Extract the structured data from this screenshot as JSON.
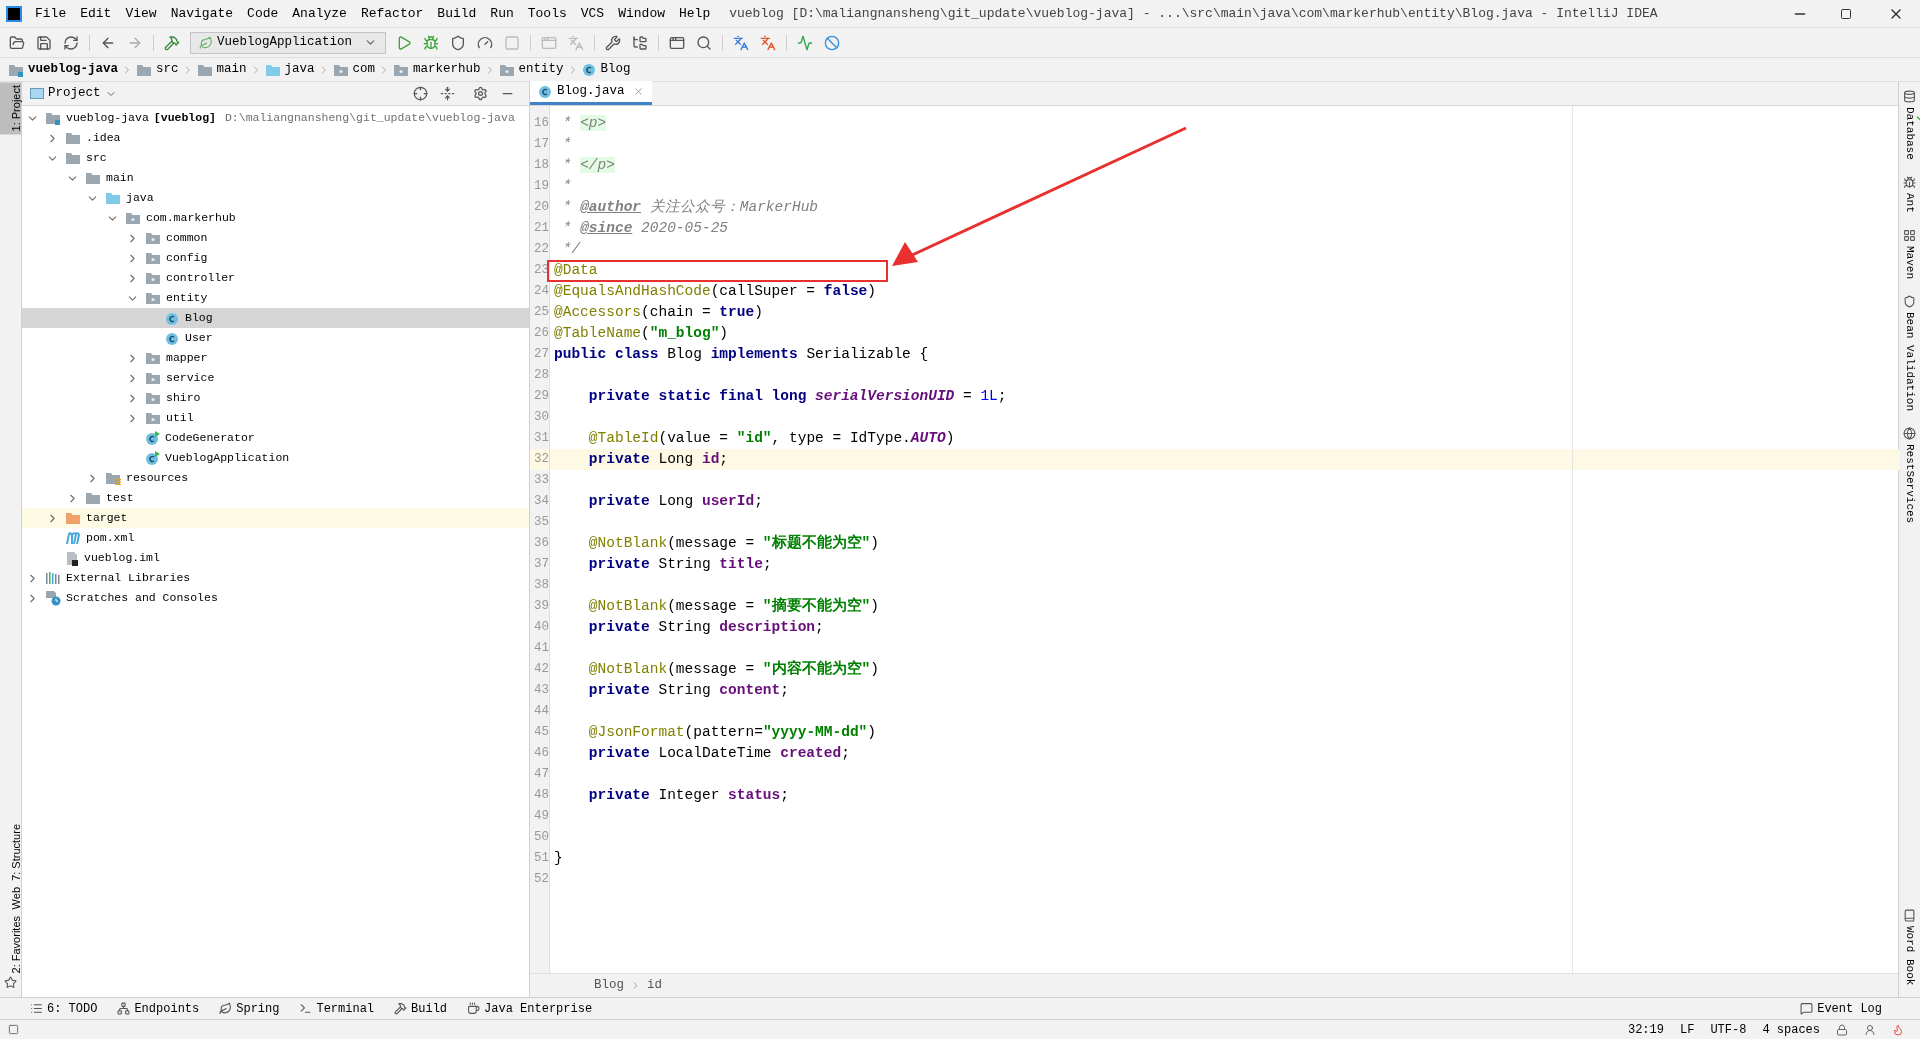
{
  "window": {
    "title": "vueblog [D:\\maliangnansheng\\git_update\\vueblog-java] - ...\\src\\main\\java\\com\\markerhub\\entity\\Blog.java - IntelliJ IDEA"
  },
  "menu": [
    "File",
    "Edit",
    "View",
    "Navigate",
    "Code",
    "Analyze",
    "Refactor",
    "Build",
    "Run",
    "Tools",
    "VCS",
    "Window",
    "Help"
  ],
  "run_config": "VueblogApplication",
  "nav_bar": [
    {
      "label": "vueblog-java",
      "kind": "module"
    },
    {
      "label": "src",
      "kind": "folder"
    },
    {
      "label": "main",
      "kind": "folder"
    },
    {
      "label": "java",
      "kind": "source-folder"
    },
    {
      "label": "com",
      "kind": "package"
    },
    {
      "label": "markerhub",
      "kind": "package"
    },
    {
      "label": "entity",
      "kind": "package"
    },
    {
      "label": "Blog",
      "kind": "class"
    }
  ],
  "left_strip": [
    {
      "label": "1: Project",
      "selected": true
    },
    {
      "label": "7: Structure",
      "selected": false
    },
    {
      "label": "Web",
      "selected": false
    },
    {
      "label": "2: Favorites",
      "selected": false
    }
  ],
  "project_panel": {
    "title": "Project",
    "tree": [
      {
        "label": "vueblog-java",
        "module_name": "[vueblog]",
        "path": "D:\\maliangnansheng\\git_update\\vueblog-java",
        "kind": "module",
        "expanded": true,
        "selected": false,
        "children": [
          {
            "label": ".idea",
            "kind": "folder",
            "expanded": false,
            "selected": false
          },
          {
            "label": "src",
            "kind": "folder",
            "expanded": true,
            "selected": false,
            "children": [
              {
                "label": "main",
                "kind": "folder",
                "expanded": true,
                "selected": false,
                "children": [
                  {
                    "label": "java",
                    "kind": "source-folder",
                    "expanded": true,
                    "selected": false,
                    "children": [
                      {
                        "label": "com.markerhub",
                        "kind": "package",
                        "expanded": true,
                        "selected": false,
                        "children": [
                          {
                            "label": "common",
                            "kind": "package",
                            "expanded": false,
                            "selected": false
                          },
                          {
                            "label": "config",
                            "kind": "package",
                            "expanded": false,
                            "selected": false
                          },
                          {
                            "label": "controller",
                            "kind": "package",
                            "expanded": false,
                            "selected": false
                          },
                          {
                            "label": "entity",
                            "kind": "package",
                            "expanded": true,
                            "selected": false,
                            "children": [
                              {
                                "label": "Blog",
                                "kind": "class",
                                "selected": true
                              },
                              {
                                "label": "User",
                                "kind": "class",
                                "selected": false
                              }
                            ]
                          },
                          {
                            "label": "mapper",
                            "kind": "package",
                            "expanded": false,
                            "selected": false
                          },
                          {
                            "label": "service",
                            "kind": "package",
                            "expanded": false,
                            "selected": false
                          },
                          {
                            "label": "shiro",
                            "kind": "package",
                            "expanded": false,
                            "selected": false
                          },
                          {
                            "label": "util",
                            "kind": "package",
                            "expanded": false,
                            "selected": false
                          },
                          {
                            "label": "CodeGenerator",
                            "kind": "runnable-class",
                            "selected": false
                          },
                          {
                            "label": "VueblogApplication",
                            "kind": "runnable-class",
                            "selected": false
                          }
                        ]
                      }
                    ]
                  },
                  {
                    "label": "resources",
                    "kind": "resources",
                    "expanded": false,
                    "selected": false
                  }
                ]
              },
              {
                "label": "test",
                "kind": "folder",
                "expanded": false,
                "selected": false
              }
            ]
          },
          {
            "label": "target",
            "kind": "excluded-folder",
            "expanded": false,
            "selected": false
          },
          {
            "label": "pom.xml",
            "kind": "maven",
            "selected": false
          },
          {
            "label": "vueblog.iml",
            "kind": "iml",
            "selected": false
          }
        ]
      },
      {
        "label": "External Libraries",
        "kind": "libraries",
        "expanded": false,
        "selected": false
      },
      {
        "label": "Scratches and Consoles",
        "kind": "scratches",
        "expanded": false,
        "selected": false
      }
    ]
  },
  "editor": {
    "tabs": [
      {
        "label": "Blog.java",
        "selected": true
      }
    ],
    "lines": [
      {
        "n": "16",
        "current": false,
        "tokens": [
          {
            "text": " * ",
            "kind": "comment"
          },
          {
            "text": "<p>",
            "kind": "tag"
          }
        ]
      },
      {
        "n": "17",
        "current": false,
        "tokens": [
          {
            "text": " *",
            "kind": "comment"
          }
        ]
      },
      {
        "n": "18",
        "current": false,
        "tokens": [
          {
            "text": " * ",
            "kind": "comment"
          },
          {
            "text": "</p>",
            "kind": "tag"
          }
        ]
      },
      {
        "n": "19",
        "current": false,
        "tokens": [
          {
            "text": " *",
            "kind": "comment"
          }
        ]
      },
      {
        "n": "20",
        "current": false,
        "tokens": [
          {
            "text": " * ",
            "kind": "comment"
          },
          {
            "text": "@author",
            "kind": "doctag"
          },
          {
            "text": " 关注公众号：MarkerHub",
            "kind": "comment"
          }
        ]
      },
      {
        "n": "21",
        "current": false,
        "tokens": [
          {
            "text": " * ",
            "kind": "comment"
          },
          {
            "text": "@since",
            "kind": "doctag"
          },
          {
            "text": " 2020-05-25",
            "kind": "comment"
          }
        ]
      },
      {
        "n": "22",
        "current": false,
        "tokens": [
          {
            "text": " */",
            "kind": "comment"
          }
        ]
      },
      {
        "n": "23",
        "current": false,
        "tokens": [
          {
            "text": "@Data",
            "kind": "annotation"
          }
        ]
      },
      {
        "n": "24",
        "current": false,
        "tokens": [
          {
            "text": "@EqualsAndHashCode",
            "kind": "annotation"
          },
          {
            "text": "(callSuper = ",
            "kind": "plain"
          },
          {
            "text": "false",
            "kind": "keyword"
          },
          {
            "text": ")",
            "kind": "plain"
          }
        ]
      },
      {
        "n": "25",
        "current": false,
        "tokens": [
          {
            "text": "@Accessors",
            "kind": "annotation"
          },
          {
            "text": "(chain = ",
            "kind": "plain"
          },
          {
            "text": "true",
            "kind": "keyword"
          },
          {
            "text": ")",
            "kind": "plain"
          }
        ]
      },
      {
        "n": "26",
        "current": false,
        "tokens": [
          {
            "text": "@TableName",
            "kind": "annotation"
          },
          {
            "text": "(",
            "kind": "plain"
          },
          {
            "text": "\"m_blog\"",
            "kind": "string"
          },
          {
            "text": ")",
            "kind": "plain"
          }
        ]
      },
      {
        "n": "27",
        "current": false,
        "tokens": [
          {
            "text": "public class ",
            "kind": "keyword"
          },
          {
            "text": "Blog ",
            "kind": "plain"
          },
          {
            "text": "implements ",
            "kind": "keyword"
          },
          {
            "text": "Serializable {",
            "kind": "plain"
          }
        ]
      },
      {
        "n": "28",
        "current": false
      },
      {
        "n": "29",
        "current": false,
        "tokens": [
          {
            "text": "    private static final long ",
            "kind": "keyword"
          },
          {
            "text": "serialVersionUID",
            "kind": "constant"
          },
          {
            "text": " = ",
            "kind": "plain"
          },
          {
            "text": "1L",
            "kind": "number"
          },
          {
            "text": ";",
            "kind": "plain"
          }
        ]
      },
      {
        "n": "30",
        "current": false
      },
      {
        "n": "31",
        "current": false,
        "tokens": [
          {
            "text": "    @TableId",
            "kind": "annotation"
          },
          {
            "text": "(value = ",
            "kind": "plain"
          },
          {
            "text": "\"id\"",
            "kind": "string"
          },
          {
            "text": ", type = IdType.",
            "kind": "plain"
          },
          {
            "text": "AUTO",
            "kind": "constant"
          },
          {
            "text": ")",
            "kind": "plain"
          }
        ]
      },
      {
        "n": "32",
        "current": true,
        "tokens": [
          {
            "text": "    private ",
            "kind": "keyword"
          },
          {
            "text": "Long ",
            "kind": "plain"
          },
          {
            "text": "id",
            "kind": "field"
          },
          {
            "text": ";",
            "kind": "plain"
          }
        ]
      },
      {
        "n": "33",
        "current": false
      },
      {
        "n": "34",
        "current": false,
        "tokens": [
          {
            "text": "    private ",
            "kind": "keyword"
          },
          {
            "text": "Long ",
            "kind": "plain"
          },
          {
            "text": "userId",
            "kind": "field"
          },
          {
            "text": ";",
            "kind": "plain"
          }
        ]
      },
      {
        "n": "35",
        "current": false
      },
      {
        "n": "36",
        "current": false,
        "tokens": [
          {
            "text": "    @NotBlank",
            "kind": "annotation"
          },
          {
            "text": "(message = ",
            "kind": "plain"
          },
          {
            "text": "\"标题不能为空\"",
            "kind": "string"
          },
          {
            "text": ")",
            "kind": "plain"
          }
        ]
      },
      {
        "n": "37",
        "current": false,
        "tokens": [
          {
            "text": "    private ",
            "kind": "keyword"
          },
          {
            "text": "String ",
            "kind": "plain"
          },
          {
            "text": "title",
            "kind": "field"
          },
          {
            "text": ";",
            "kind": "plain"
          }
        ]
      },
      {
        "n": "38",
        "current": false
      },
      {
        "n": "39",
        "current": false,
        "tokens": [
          {
            "text": "    @NotBlank",
            "kind": "annotation"
          },
          {
            "text": "(message = ",
            "kind": "plain"
          },
          {
            "text": "\"摘要不能为空\"",
            "kind": "string"
          },
          {
            "text": ")",
            "kind": "plain"
          }
        ]
      },
      {
        "n": "40",
        "current": false,
        "tokens": [
          {
            "text": "    private ",
            "kind": "keyword"
          },
          {
            "text": "String ",
            "kind": "plain"
          },
          {
            "text": "description",
            "kind": "field"
          },
          {
            "text": ";",
            "kind": "plain"
          }
        ]
      },
      {
        "n": "41",
        "current": false
      },
      {
        "n": "42",
        "current": false,
        "tokens": [
          {
            "text": "    @NotBlank",
            "kind": "annotation"
          },
          {
            "text": "(message = ",
            "kind": "plain"
          },
          {
            "text": "\"内容不能为空\"",
            "kind": "string"
          },
          {
            "text": ")",
            "kind": "plain"
          }
        ]
      },
      {
        "n": "43",
        "current": false,
        "tokens": [
          {
            "text": "    private ",
            "kind": "keyword"
          },
          {
            "text": "String ",
            "kind": "plain"
          },
          {
            "text": "content",
            "kind": "field"
          },
          {
            "text": ";",
            "kind": "plain"
          }
        ]
      },
      {
        "n": "44",
        "current": false
      },
      {
        "n": "45",
        "current": false,
        "tokens": [
          {
            "text": "    @JsonFormat",
            "kind": "annotation"
          },
          {
            "text": "(pattern=",
            "kind": "plain"
          },
          {
            "text": "\"yyyy-MM-dd\"",
            "kind": "string"
          },
          {
            "text": ")",
            "kind": "plain"
          }
        ]
      },
      {
        "n": "46",
        "current": false,
        "tokens": [
          {
            "text": "    private ",
            "kind": "keyword"
          },
          {
            "text": "LocalDateTime ",
            "kind": "plain"
          },
          {
            "text": "created",
            "kind": "field"
          },
          {
            "text": ";",
            "kind": "plain"
          }
        ]
      },
      {
        "n": "47",
        "current": false
      },
      {
        "n": "48",
        "current": false,
        "tokens": [
          {
            "text": "    private ",
            "kind": "keyword"
          },
          {
            "text": "Integer ",
            "kind": "plain"
          },
          {
            "text": "status",
            "kind": "field"
          },
          {
            "text": ";",
            "kind": "plain"
          }
        ]
      },
      {
        "n": "49",
        "current": false
      },
      {
        "n": "50",
        "current": false
      },
      {
        "n": "51",
        "current": false,
        "tokens": [
          {
            "text": "}",
            "kind": "plain"
          }
        ]
      },
      {
        "n": "52",
        "current": false
      }
    ],
    "breadcrumb": [
      "Blog",
      "id"
    ]
  },
  "right_strip": [
    {
      "label": "Database",
      "kind": "database"
    },
    {
      "label": "Ant",
      "kind": "ant"
    },
    {
      "label": "Maven",
      "kind": "maven"
    },
    {
      "label": "Bean Validation",
      "kind": "bean"
    },
    {
      "label": "RestServices",
      "kind": "rest"
    },
    {
      "label": "Word Book",
      "kind": "book"
    }
  ],
  "tool_windows": [
    {
      "label": "6: TODO",
      "kind": "todo"
    },
    {
      "label": "Endpoints",
      "kind": "endpoints"
    },
    {
      "label": "Spring",
      "kind": "spring"
    },
    {
      "label": "Terminal",
      "kind": "terminal"
    },
    {
      "label": "Build",
      "kind": "build"
    },
    {
      "label": "Java Enterprise",
      "kind": "javaee"
    }
  ],
  "event_log": "Event Log",
  "status_bar": {
    "position": "32:19",
    "line_separator": "LF",
    "encoding": "UTF-8",
    "indent": "4 spaces"
  }
}
